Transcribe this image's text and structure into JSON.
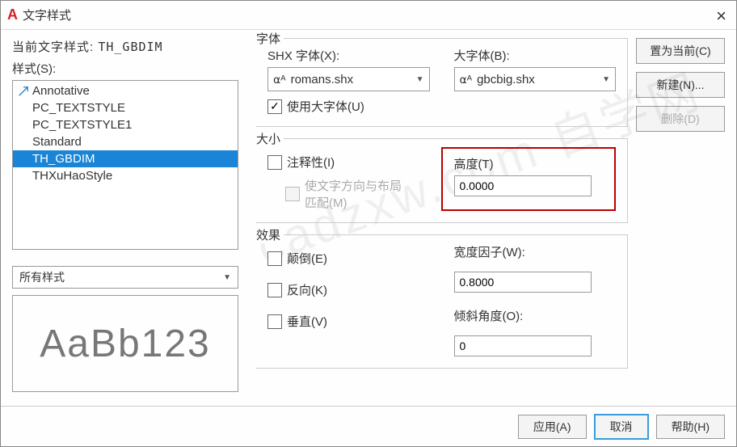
{
  "window": {
    "title": "文字样式"
  },
  "currentStyle": {
    "label": "当前文字样式:",
    "value": "TH_GBDIM"
  },
  "stylesSection": {
    "label": "样式(S):"
  },
  "styles": [
    {
      "name": "Annotative",
      "annotative": true
    },
    {
      "name": "PC_TEXTSTYLE",
      "annotative": false
    },
    {
      "name": "PC_TEXTSTYLE1",
      "annotative": false
    },
    {
      "name": "Standard",
      "annotative": false
    },
    {
      "name": "TH_GBDIM",
      "annotative": false,
      "selected": true
    },
    {
      "name": "THXuHaoStyle",
      "annotative": false
    }
  ],
  "filter": {
    "value": "所有样式"
  },
  "preview": {
    "text": "AaBb123"
  },
  "fontGroup": {
    "title": "字体",
    "shxLabel": "SHX 字体(X):",
    "shxValue": "romans.shx",
    "bigLabel": "大字体(B):",
    "bigValue": "gbcbig.shx",
    "useBigFont": "使用大字体(U)",
    "useBigFontChecked": true
  },
  "sizeGroup": {
    "title": "大小",
    "annotativeLabel": "注释性(I)",
    "matchOrientLabel1": "使文字方向与布局",
    "matchOrientLabel2": "匹配(M)",
    "heightLabel": "高度(T)",
    "heightValue": "0.0000"
  },
  "effectsGroup": {
    "title": "效果",
    "upsideDown": "颠倒(E)",
    "backwards": "反向(K)",
    "vertical": "垂直(V)",
    "widthFactorLabel": "宽度因子(W):",
    "widthFactorValue": "0.8000",
    "obliqueLabel": "倾斜角度(O):",
    "obliqueValue": "0"
  },
  "buttons": {
    "setCurrent": "置为当前(C)",
    "new": "新建(N)...",
    "delete": "删除(D)"
  },
  "footer": {
    "apply": "应用(A)",
    "cancel": "取消",
    "help": "帮助(H)"
  },
  "watermark": "cadzxw.com 自学网"
}
